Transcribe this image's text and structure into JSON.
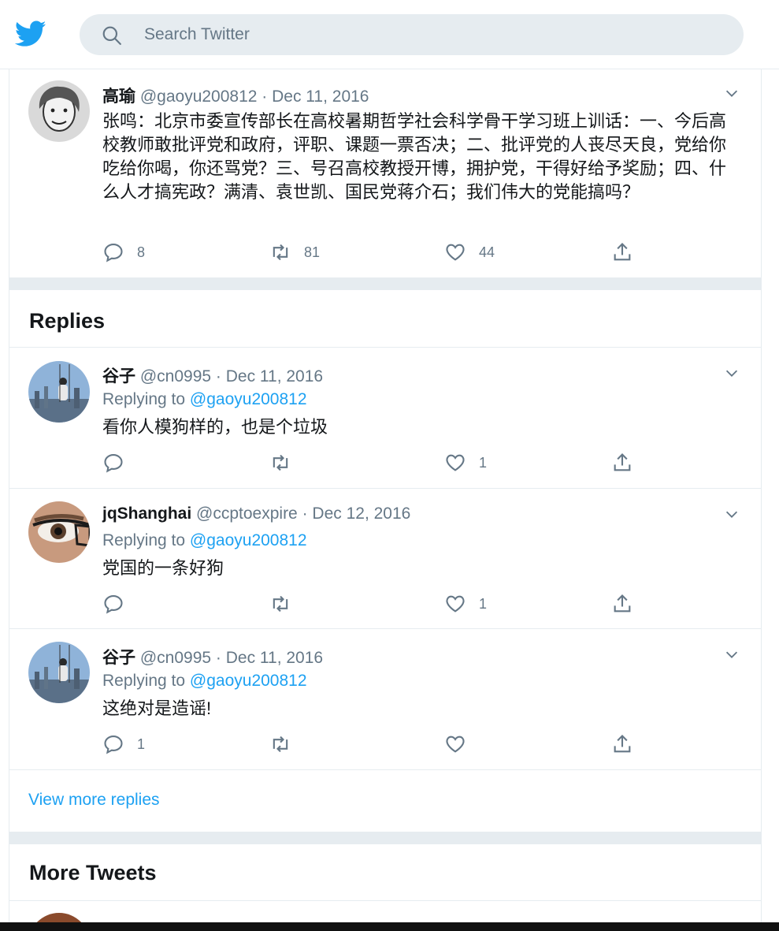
{
  "search": {
    "placeholder": "Search Twitter"
  },
  "main_tweet": {
    "display_name": "高瑜",
    "meta": "@gaoyu200812 · Dec 11, 2016",
    "text": "张鸣：北京市委宣传部长在高校暑期哲学社会科学骨干学习班上训话：一、今后高校教师敢批评党和政府，评职、课题一票否决；二、批评党的人丧尽天良，党给你吃给你喝，你还骂党？三、号召高校教授开博，拥护党，干得好给予奖励；四、什么人才搞宪政？满清、袁世凯、国民党蒋介石；我们伟大的党能搞吗？",
    "replies": "8",
    "retweets": "81",
    "likes": "44"
  },
  "replies_section": {
    "title": "Replies"
  },
  "replies": [
    {
      "display_name": "谷子",
      "meta": "@cn0995 · Dec 11, 2016",
      "replying_prefix": "Replying to ",
      "replying_handle": "@gaoyu200812",
      "text": "看你人模狗样的，也是个垃圾",
      "replies": "",
      "retweets": "",
      "likes": "1"
    },
    {
      "display_name": "jqShanghai",
      "meta": "@ccptoexpire · Dec 12, 2016",
      "replying_prefix": "Replying to ",
      "replying_handle": "@gaoyu200812",
      "text": "党国的一条好狗",
      "replies": "",
      "retweets": "",
      "likes": "1"
    },
    {
      "display_name": "谷子",
      "meta": "@cn0995 · Dec 11, 2016",
      "replying_prefix": "Replying to ",
      "replying_handle": "@gaoyu200812",
      "text": "这绝对是造谣!",
      "replies": "1",
      "retweets": "",
      "likes": ""
    }
  ],
  "view_more": "View more replies",
  "more_tweets": {
    "title": "More Tweets"
  },
  "colors": {
    "accent": "#1da1f2",
    "muted": "#657786",
    "border": "#e6ecf0"
  }
}
